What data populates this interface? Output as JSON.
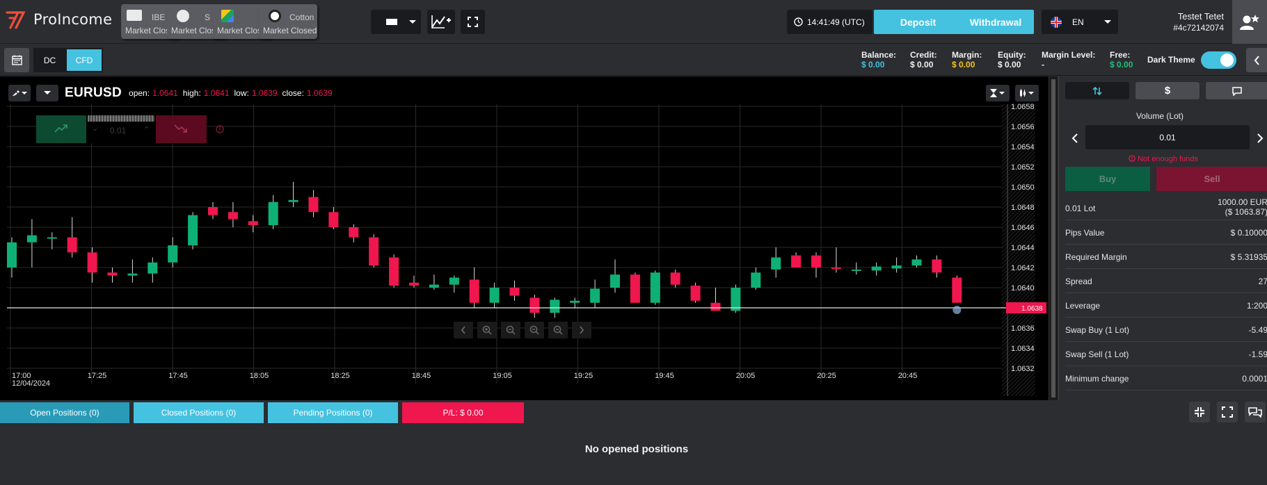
{
  "header": {
    "brand": "ProIncome",
    "asset_tabs": [
      {
        "symbol": "IBE",
        "status": "Market Closed"
      },
      {
        "symbol": "S",
        "status": "Market Closed"
      },
      {
        "symbol": "",
        "status": "Market Closed"
      },
      {
        "symbol": "Cotton",
        "status": "Market Closed"
      }
    ],
    "time": "14:41:49 (UTC)",
    "deposit_label": "Deposit",
    "withdrawal_label": "Withdrawal",
    "language": "EN",
    "user_name": "Testet Tetet",
    "user_id": "#4c72142074"
  },
  "toolbar": {
    "mode_dc": "DC",
    "mode_cfd": "CFD",
    "stats": [
      {
        "label": "Balance:",
        "value": "$ 0.00",
        "color": "#45c2e0"
      },
      {
        "label": "Credit:",
        "value": "$ 0.00",
        "color": "#f0f0f0"
      },
      {
        "label": "Margin:",
        "value": "$ 0.00",
        "color": "#f5c518"
      },
      {
        "label": "Equity:",
        "value": "$ 0.00",
        "color": "#f0f0f0"
      },
      {
        "label": "Margin Level:",
        "value": "-",
        "color": "#f0f0f0"
      },
      {
        "label": "Free:",
        "value": "$ 0.00",
        "color": "#21c17a"
      }
    ],
    "theme_label": "Dark Theme"
  },
  "chart_header": {
    "symbol": "EURUSD",
    "open_label": "open:",
    "open": "1.0641",
    "high_label": "high:",
    "high": "1.0641",
    "low_label": "low:",
    "low": "1.0639",
    "close_label": "close:",
    "close": "1.0639",
    "trade_widget_value": "0.01"
  },
  "chart_data": {
    "type": "candlestick",
    "x_ticks": [
      "17:00",
      "17:25",
      "17:45",
      "18:05",
      "18:25",
      "18:45",
      "19:05",
      "19:25",
      "19:45",
      "20:05",
      "20:25",
      "20:45"
    ],
    "x_date": "12/04/2024",
    "y_ticks": [
      "1.0658",
      "1.0656",
      "1.0654",
      "1.0652",
      "1.0650",
      "1.0648",
      "1.0646",
      "1.0644",
      "1.0642",
      "1.0640",
      "1.0638",
      "1.0636",
      "1.0634",
      "1.0632"
    ],
    "ylim": [
      1.0631,
      1.0659
    ],
    "current_price": "1.0638",
    "current_value": 1.0638,
    "up_color": "#0fb076",
    "down_color": "#f0164e",
    "candles": [
      {
        "o": 1.0642,
        "h": 1.0645,
        "l": 1.0641,
        "c": 1.06445
      },
      {
        "o": 1.06445,
        "h": 1.06468,
        "l": 1.0642,
        "c": 1.06452
      },
      {
        "o": 1.0645,
        "h": 1.06455,
        "l": 1.06438,
        "c": 1.0645
      },
      {
        "o": 1.0645,
        "h": 1.0647,
        "l": 1.0643,
        "c": 1.06435
      },
      {
        "o": 1.06435,
        "h": 1.0644,
        "l": 1.06405,
        "c": 1.06415
      },
      {
        "o": 1.06415,
        "h": 1.0642,
        "l": 1.06405,
        "c": 1.06412
      },
      {
        "o": 1.06412,
        "h": 1.06428,
        "l": 1.06405,
        "c": 1.06414
      },
      {
        "o": 1.06414,
        "h": 1.0643,
        "l": 1.06405,
        "c": 1.06425
      },
      {
        "o": 1.06425,
        "h": 1.0645,
        "l": 1.0642,
        "c": 1.06442
      },
      {
        "o": 1.06442,
        "h": 1.06475,
        "l": 1.06438,
        "c": 1.06472
      },
      {
        "o": 1.0648,
        "h": 1.06485,
        "l": 1.06468,
        "c": 1.06472
      },
      {
        "o": 1.06475,
        "h": 1.06485,
        "l": 1.0646,
        "c": 1.06468
      },
      {
        "o": 1.06466,
        "h": 1.06472,
        "l": 1.06455,
        "c": 1.06462
      },
      {
        "o": 1.06462,
        "h": 1.06492,
        "l": 1.06458,
        "c": 1.06485
      },
      {
        "o": 1.06485,
        "h": 1.06505,
        "l": 1.0648,
        "c": 1.06487
      },
      {
        "o": 1.0649,
        "h": 1.06497,
        "l": 1.0647,
        "c": 1.06475
      },
      {
        "o": 1.06475,
        "h": 1.0648,
        "l": 1.06458,
        "c": 1.0646
      },
      {
        "o": 1.0646,
        "h": 1.06463,
        "l": 1.06445,
        "c": 1.0645
      },
      {
        "o": 1.0645,
        "h": 1.06453,
        "l": 1.0642,
        "c": 1.06422
      },
      {
        "o": 1.0643,
        "h": 1.06433,
        "l": 1.064,
        "c": 1.06402
      },
      {
        "o": 1.06405,
        "h": 1.06412,
        "l": 1.064,
        "c": 1.06402
      },
      {
        "o": 1.064,
        "h": 1.06413,
        "l": 1.06398,
        "c": 1.06403
      },
      {
        "o": 1.06403,
        "h": 1.06412,
        "l": 1.06395,
        "c": 1.0641
      },
      {
        "o": 1.06408,
        "h": 1.0642,
        "l": 1.0638,
        "c": 1.06385
      },
      {
        "o": 1.06385,
        "h": 1.06405,
        "l": 1.0638,
        "c": 1.064
      },
      {
        "o": 1.064,
        "h": 1.06407,
        "l": 1.06387,
        "c": 1.06392
      },
      {
        "o": 1.0639,
        "h": 1.06393,
        "l": 1.0637,
        "c": 1.06375
      },
      {
        "o": 1.06375,
        "h": 1.0639,
        "l": 1.0637,
        "c": 1.06388
      },
      {
        "o": 1.06385,
        "h": 1.0639,
        "l": 1.0638,
        "c": 1.06387
      },
      {
        "o": 1.06385,
        "h": 1.06408,
        "l": 1.0638,
        "c": 1.06399
      },
      {
        "o": 1.064,
        "h": 1.06428,
        "l": 1.06395,
        "c": 1.06413
      },
      {
        "o": 1.06413,
        "h": 1.06415,
        "l": 1.06385,
        "c": 1.06385
      },
      {
        "o": 1.06385,
        "h": 1.06417,
        "l": 1.06383,
        "c": 1.06415
      },
      {
        "o": 1.06415,
        "h": 1.06418,
        "l": 1.064,
        "c": 1.06403
      },
      {
        "o": 1.06402,
        "h": 1.06405,
        "l": 1.06385,
        "c": 1.06387
      },
      {
        "o": 1.06385,
        "h": 1.064,
        "l": 1.0638,
        "c": 1.06377
      },
      {
        "o": 1.06377,
        "h": 1.06403,
        "l": 1.06375,
        "c": 1.064
      },
      {
        "o": 1.064,
        "h": 1.0642,
        "l": 1.06398,
        "c": 1.06415
      },
      {
        "o": 1.06418,
        "h": 1.0644,
        "l": 1.0641,
        "c": 1.0643
      },
      {
        "o": 1.06432,
        "h": 1.06435,
        "l": 1.0642,
        "c": 1.0642
      },
      {
        "o": 1.06432,
        "h": 1.06435,
        "l": 1.0641,
        "c": 1.0642
      },
      {
        "o": 1.0642,
        "h": 1.0644,
        "l": 1.06415,
        "c": 1.06419
      },
      {
        "o": 1.06418,
        "h": 1.06425,
        "l": 1.06413,
        "c": 1.06418
      },
      {
        "o": 1.06417,
        "h": 1.06425,
        "l": 1.06412,
        "c": 1.06421
      },
      {
        "o": 1.06419,
        "h": 1.0643,
        "l": 1.06415,
        "c": 1.06422
      },
      {
        "o": 1.06422,
        "h": 1.06432,
        "l": 1.0642,
        "c": 1.06428
      },
      {
        "o": 1.06428,
        "h": 1.06432,
        "l": 1.0641,
        "c": 1.06415
      },
      {
        "o": 1.0641,
        "h": 1.06412,
        "l": 1.06385,
        "c": 1.06385
      }
    ]
  },
  "trade_panel": {
    "volume_label": "Volume (Lot)",
    "volume_value": "0.01",
    "error": "Not enough funds",
    "buy_label": "Buy",
    "sell_label": "Sell",
    "rows": [
      {
        "label": "0.01 Lot",
        "value": "1000.00 EUR",
        "value2": "($ 1063.87)"
      },
      {
        "label": "Pips Value",
        "value": "$ 0.10000"
      },
      {
        "label": "Required Margin",
        "value": "$ 5.31935"
      },
      {
        "label": "Spread",
        "value": "27"
      },
      {
        "label": "Leverage",
        "value": "1:200"
      },
      {
        "label": "Swap Buy (1 Lot)",
        "value": "-5.49"
      },
      {
        "label": "Swap Sell (1 Lot)",
        "value": "-1.59"
      },
      {
        "label": "Minimum change",
        "value": "0.0001"
      }
    ]
  },
  "positions": {
    "tabs": [
      {
        "label": "Open Positions  (0)"
      },
      {
        "label": "Closed Positions  (0)"
      },
      {
        "label": "Pending Positions  (0)"
      },
      {
        "label": "P/L:  $ 0.00"
      }
    ],
    "empty_message": "No opened positions"
  }
}
